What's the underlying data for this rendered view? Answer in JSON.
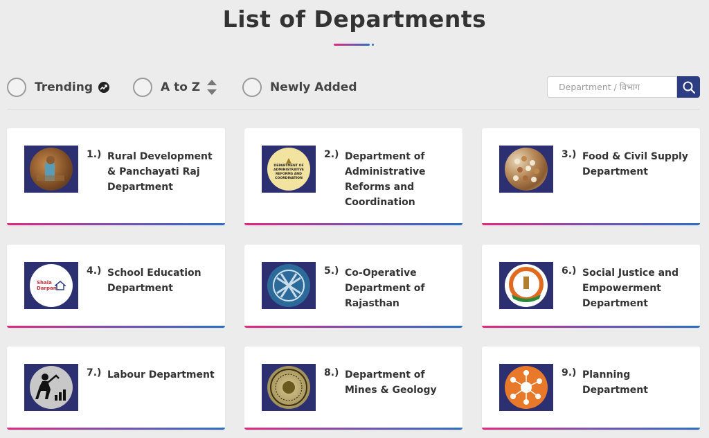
{
  "page": {
    "title": "List of Departments"
  },
  "filters": [
    {
      "label": "Trending",
      "icon": "trending-icon"
    },
    {
      "label": "A to Z",
      "icon": "sort-icon"
    },
    {
      "label": "Newly Added",
      "icon": ""
    }
  ],
  "search": {
    "placeholder": "Department / विभाग",
    "value": "",
    "button_icon": "search-icon"
  },
  "colors": {
    "accent_pink": "#e3287f",
    "accent_blue": "#2b6fc2",
    "thumb_bg": "#2c3070",
    "search_btn": "#2c3d84"
  },
  "departments": [
    {
      "num": "1.)",
      "name": "Rural Development & Panchayati Raj Department",
      "icon": "rural-development-photo"
    },
    {
      "num": "2.)",
      "name": "Department of Administrative Reforms and Coordination",
      "icon": "administrative-reforms-logo",
      "logo_text": "DEPARTMENT OF ADMINISTRATIVE REFORMS AND COORDINATION"
    },
    {
      "num": "3.)",
      "name": "Food & Civil Supply Department",
      "icon": "grains-photo"
    },
    {
      "num": "4.)",
      "name": "School Education Department",
      "icon": "shala-darpan-logo",
      "logo_text": "Shala Darpan"
    },
    {
      "num": "5.)",
      "name": "Co-Operative Department of Rajasthan",
      "icon": "cooperative-hands-logo"
    },
    {
      "num": "6.)",
      "name": "Social Justice and Empowerment Department",
      "icon": "social-justice-emblem"
    },
    {
      "num": "7.)",
      "name": "Labour Department",
      "icon": "labour-worker-icon"
    },
    {
      "num": "8.)",
      "name": "Department of Mines & Geology",
      "icon": "mines-geology-seal"
    },
    {
      "num": "9.)",
      "name": "Planning Department",
      "icon": "planning-network-icon"
    }
  ]
}
